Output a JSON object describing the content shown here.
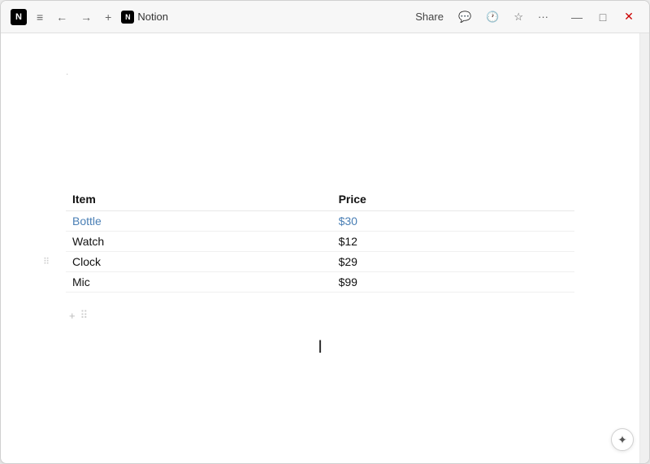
{
  "app": {
    "title": "Notion",
    "icon_label": "N"
  },
  "titlebar": {
    "share_label": "Share",
    "nav": {
      "back_label": "←",
      "forward_label": "→",
      "new_tab_label": "+",
      "menu_label": "≡"
    },
    "actions": {
      "comment_label": "💬",
      "history_label": "🕐",
      "star_label": "☆",
      "more_label": "···"
    },
    "window_controls": {
      "minimize": "—",
      "maximize": "□",
      "close": "✕"
    }
  },
  "table": {
    "headers": [
      "Item",
      "Price"
    ],
    "rows": [
      {
        "item": "Bottle",
        "price": "$30"
      },
      {
        "item": "Watch",
        "price": "$12"
      },
      {
        "item": "Clock",
        "price": "$29"
      },
      {
        "item": "Mic",
        "price": "$99"
      }
    ]
  },
  "ui": {
    "add_row_plus": "+",
    "drag_icon": "⠿",
    "bottom_btn": "✦",
    "dot": "."
  }
}
